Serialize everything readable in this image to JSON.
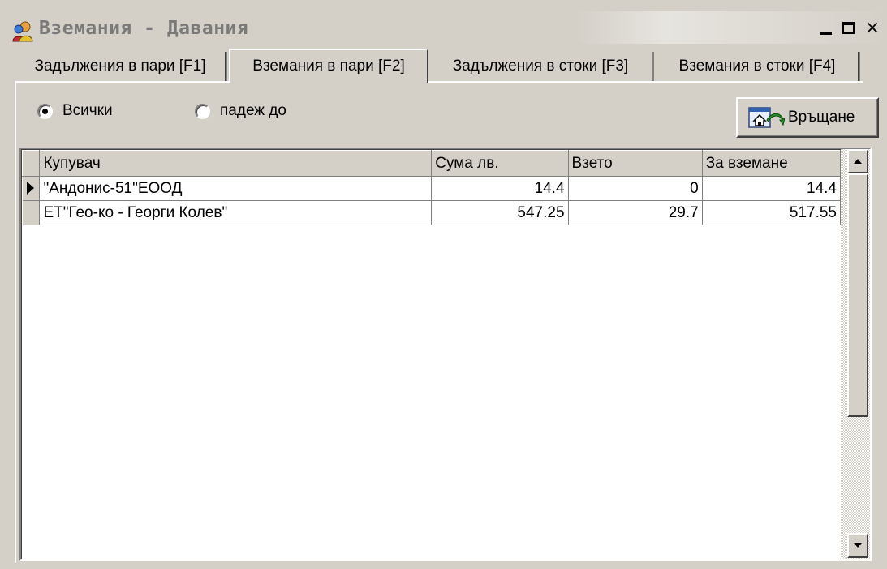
{
  "window": {
    "title": "Вземания - Давания",
    "icons": {
      "app": "people-icon",
      "minimize": "minimize-icon",
      "maximize": "maximize-icon",
      "close": "close-icon"
    },
    "close_label": "×"
  },
  "tabs": [
    {
      "label": "Задължения в пари [F1]",
      "active": false
    },
    {
      "label": "Вземания в пари [F2]",
      "active": true
    },
    {
      "label": "Задължения в стоки [F3]",
      "active": false
    },
    {
      "label": "Вземания в стоки [F4]",
      "active": false
    }
  ],
  "filter": {
    "options": [
      {
        "label": "Всички",
        "checked": true
      },
      {
        "label": "падеж до",
        "checked": false
      }
    ]
  },
  "return_button": {
    "label": "Връщане",
    "icon": "home-return-icon"
  },
  "grid": {
    "columns": [
      "Купувач",
      "Сума лв.",
      "Взето",
      "За вземане"
    ],
    "rows": [
      {
        "buyer": "\"Андонис-51\"ЕООД",
        "sum": "14.4",
        "taken": "0",
        "due": "14.4",
        "current": true
      },
      {
        "buyer": "ЕТ\"Гео-ко - Георги Колев\"",
        "sum": "547.25",
        "taken": "29.7",
        "due": "517.55",
        "current": false
      }
    ]
  },
  "colors": {
    "face": "#d4d0c8",
    "title_text": "#7a7a7a",
    "grid_bg": "#ffffff"
  }
}
